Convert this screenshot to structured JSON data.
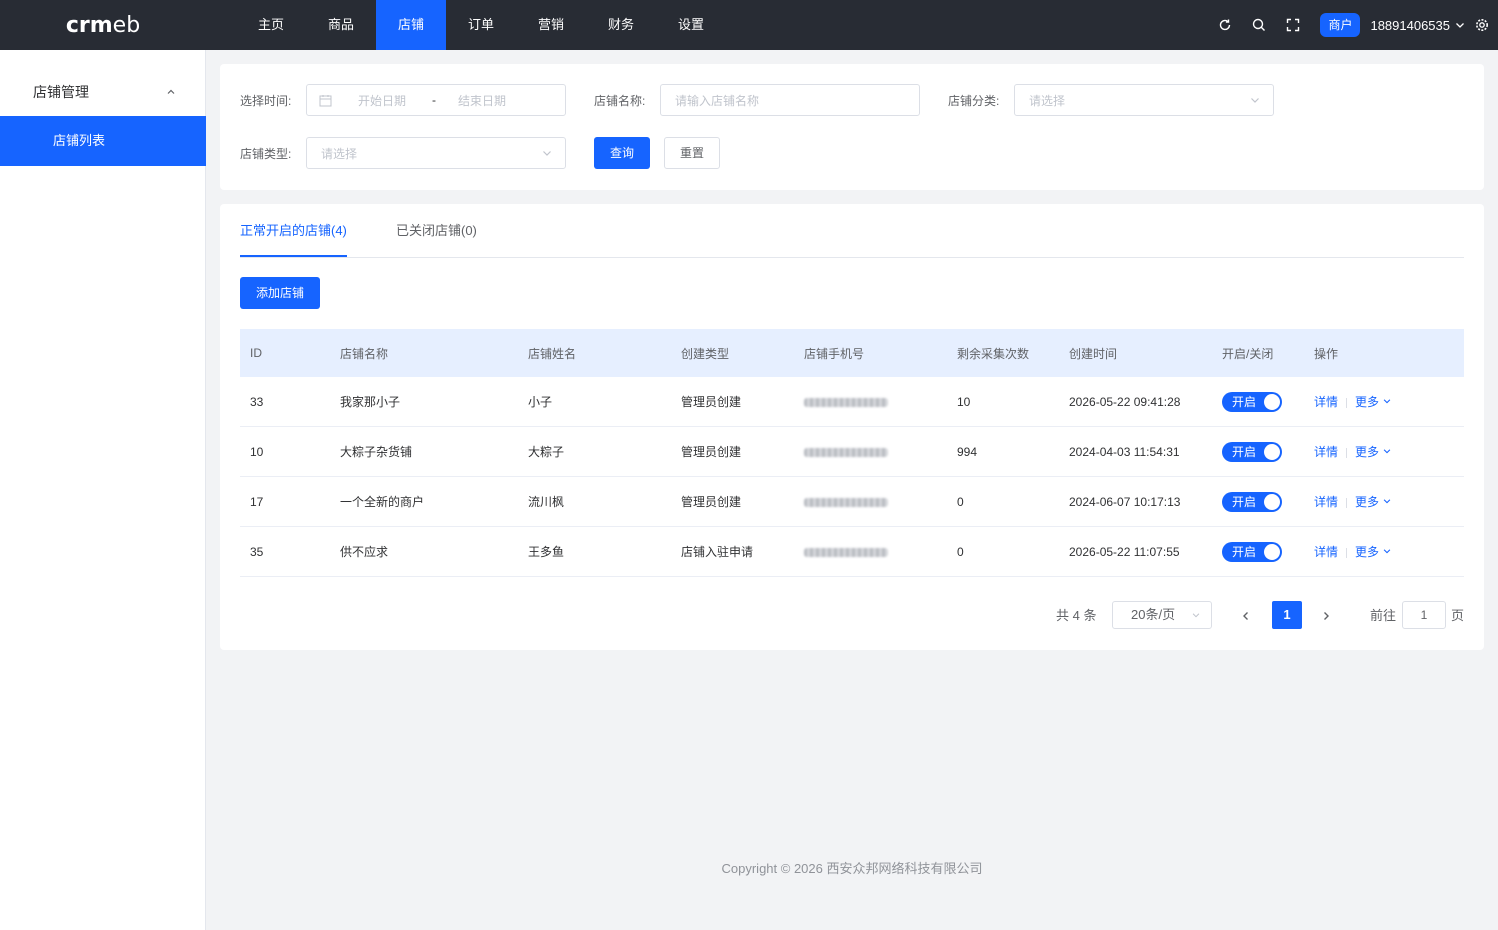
{
  "app": {
    "logo_a": "crm",
    "logo_b": "eb"
  },
  "nav": {
    "items": [
      "主页",
      "商品",
      "店铺",
      "订单",
      "营销",
      "财务",
      "设置"
    ],
    "active_index": 2
  },
  "header": {
    "icons": [
      "refresh-icon",
      "search-icon",
      "fullscreen-icon"
    ],
    "role_badge": "商户",
    "phone": "18891406535",
    "settings_icon": "gear-icon"
  },
  "sidebar": {
    "group_label": "店铺管理",
    "item_label": "店铺列表"
  },
  "filter": {
    "time_label": "选择时间:",
    "start_placeholder": "开始日期",
    "range_sep": "-",
    "end_placeholder": "结束日期",
    "name_label": "店铺名称:",
    "name_placeholder": "请输入店铺名称",
    "category_label": "店铺分类:",
    "category_placeholder": "请选择",
    "type_label": "店铺类型:",
    "type_placeholder": "请选择",
    "query_button": "查询",
    "reset_button": "重置"
  },
  "tabs": {
    "open": "正常开启的店铺(4)",
    "closed": "已关闭店铺(0)"
  },
  "add_button": "添加店铺",
  "table": {
    "columns": [
      "ID",
      "店铺名称",
      "店铺姓名",
      "创建类型",
      "店铺手机号",
      "剩余采集次数",
      "创建时间",
      "开启/关闭",
      "操作"
    ],
    "rows": [
      {
        "id": "33",
        "name": "我家那小子",
        "owner": "小子",
        "type": "管理员创建",
        "count": "10",
        "time": "2026-05-22 09:41:28",
        "switch": "开启"
      },
      {
        "id": "10",
        "name": "大粽子杂货铺",
        "owner": "大粽子",
        "type": "管理员创建",
        "count": "994",
        "time": "2024-04-03 11:54:31",
        "switch": "开启"
      },
      {
        "id": "17",
        "name": "一个全新的商户",
        "owner": "流川枫",
        "type": "管理员创建",
        "count": "0",
        "time": "2024-06-07 10:17:13",
        "switch": "开启"
      },
      {
        "id": "35",
        "name": "供不应求",
        "owner": "王多鱼",
        "type": "店铺入驻申请",
        "count": "0",
        "time": "2026-05-22 11:07:55",
        "switch": "开启"
      }
    ],
    "detail_label": "详情",
    "more_label": "更多"
  },
  "pagination": {
    "total": "共 4 条",
    "page_size": "20条/页",
    "current": "1",
    "goto": "前往",
    "goto_value": "1",
    "page_unit": "页"
  },
  "footer": "Copyright © 2026 西安众邦网络科技有限公司",
  "colors": {
    "primary": "#1664ff",
    "topbar": "#282c34"
  }
}
